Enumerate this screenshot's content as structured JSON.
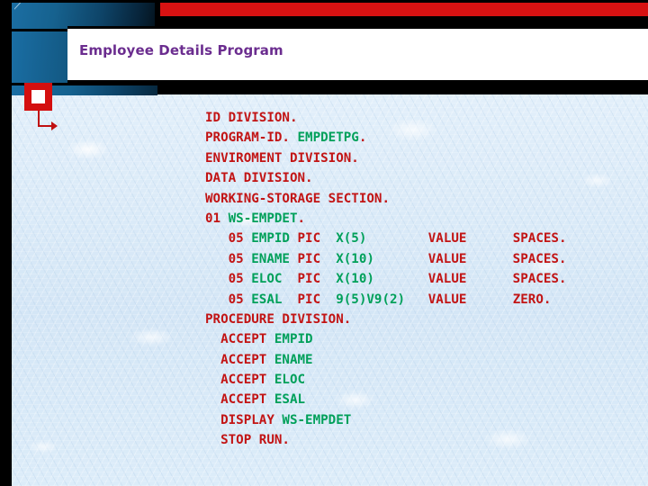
{
  "slide": {
    "title": "Employee Details Program",
    "title_color": "#6b2d8f",
    "background_color": "#dbeaf7",
    "accent_red": "#d81212",
    "accent_blue": "#1a6ea4",
    "keyword_color": "#c21414",
    "identifier_color": "#00a05a"
  },
  "decorations": {
    "top_red_bar": "red-bar",
    "blue_panel": "blue-gradient-panel",
    "marker": "red-square-bullet",
    "arrow": "red-arrow"
  },
  "code": {
    "language": "COBOL",
    "lines": [
      [
        {
          "t": "ID DIVISION.",
          "c": "kw"
        }
      ],
      [
        {
          "t": "PROGRAM-ID. ",
          "c": "kw"
        },
        {
          "t": "EMPDETPG",
          "c": "id"
        },
        {
          "t": ".",
          "c": "kw"
        }
      ],
      [
        {
          "t": "ENVIROMENT DIVISION.",
          "c": "kw"
        }
      ],
      [
        {
          "t": "DATA DIVISION.",
          "c": "kw"
        }
      ],
      [
        {
          "t": "WORKING-STORAGE SECTION.",
          "c": "kw"
        }
      ],
      [
        {
          "t": "01 ",
          "c": "kw"
        },
        {
          "t": "WS-EMPDET",
          "c": "id"
        },
        {
          "t": ".",
          "c": "kw"
        }
      ],
      [
        {
          "t": "   05 ",
          "c": "kw"
        },
        {
          "t": "EMPID",
          "c": "id"
        },
        {
          "t": " PIC ",
          "c": "kw"
        },
        {
          "t": " X(5)",
          "c": "id"
        },
        {
          "t": "        VALUE      SPACES.",
          "c": "kw"
        }
      ],
      [
        {
          "t": "   05 ",
          "c": "kw"
        },
        {
          "t": "ENAME",
          "c": "id"
        },
        {
          "t": " PIC ",
          "c": "kw"
        },
        {
          "t": " X(10)",
          "c": "id"
        },
        {
          "t": "       VALUE      SPACES.",
          "c": "kw"
        }
      ],
      [
        {
          "t": "   05 ",
          "c": "kw"
        },
        {
          "t": "ELOC ",
          "c": "id"
        },
        {
          "t": " PIC ",
          "c": "kw"
        },
        {
          "t": " X(10)",
          "c": "id"
        },
        {
          "t": "       VALUE      SPACES.",
          "c": "kw"
        }
      ],
      [
        {
          "t": "   05 ",
          "c": "kw"
        },
        {
          "t": "ESAL ",
          "c": "id"
        },
        {
          "t": " PIC ",
          "c": "kw"
        },
        {
          "t": " 9(5)V9(2)",
          "c": "id"
        },
        {
          "t": "   VALUE      ZERO.",
          "c": "kw"
        }
      ],
      [
        {
          "t": "PROCEDURE DIVISION.",
          "c": "kw"
        }
      ],
      [
        {
          "t": "  ACCEPT ",
          "c": "kw"
        },
        {
          "t": "EMPID",
          "c": "id"
        }
      ],
      [
        {
          "t": "  ACCEPT ",
          "c": "kw"
        },
        {
          "t": "ENAME",
          "c": "id"
        }
      ],
      [
        {
          "t": "  ACCEPT ",
          "c": "kw"
        },
        {
          "t": "ELOC",
          "c": "id"
        }
      ],
      [
        {
          "t": "  ACCEPT ",
          "c": "kw"
        },
        {
          "t": "ESAL",
          "c": "id"
        }
      ],
      [
        {
          "t": "  DISPLAY ",
          "c": "kw"
        },
        {
          "t": "WS-EMPDET",
          "c": "id"
        }
      ],
      [
        {
          "t": "  STOP RUN.",
          "c": "kw"
        }
      ]
    ]
  }
}
